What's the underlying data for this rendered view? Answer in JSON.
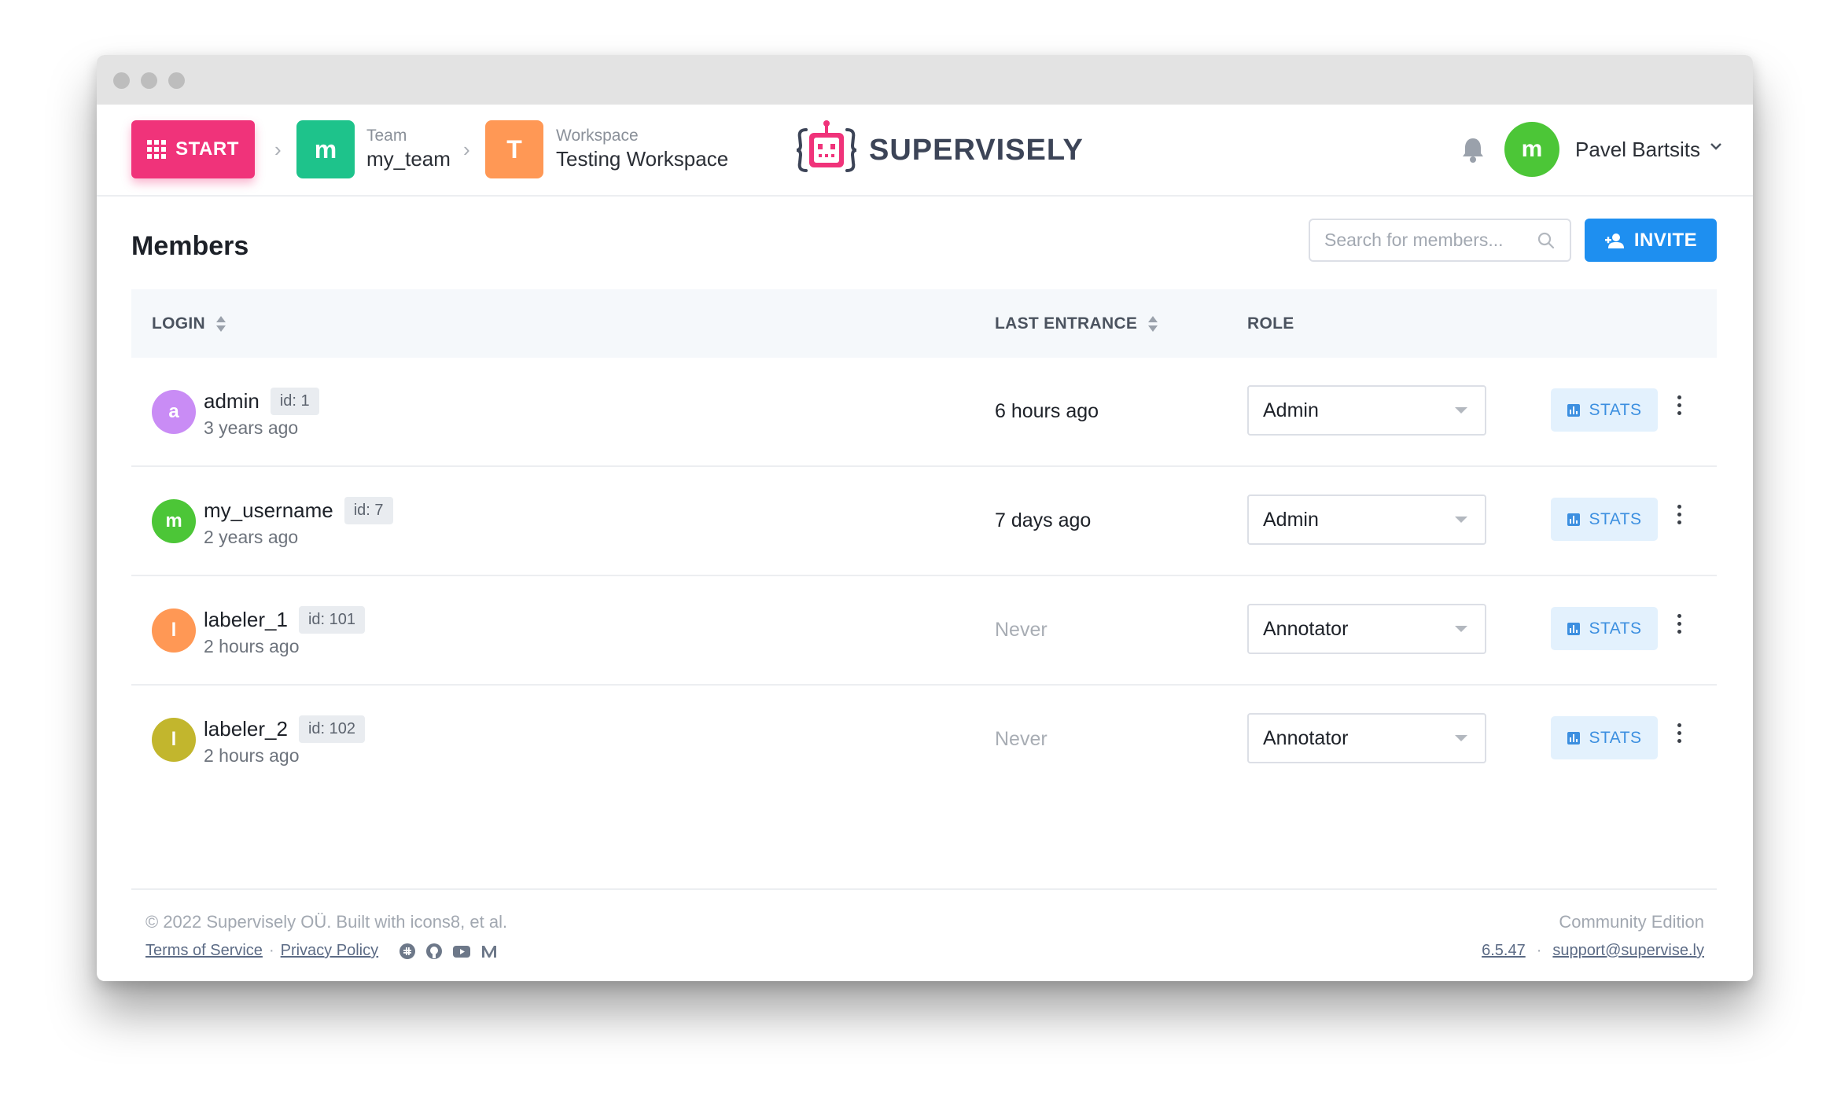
{
  "colors": {
    "start": "#f0337a",
    "team_avatar": "#1ec38b",
    "workspace_avatar": "#ff9855",
    "primary": "#1e8ff0",
    "user_avatar": "#4cc637"
  },
  "header": {
    "start_label": "START",
    "team": {
      "initial": "m",
      "label": "Team",
      "value": "my_team"
    },
    "workspace": {
      "initial": "T",
      "label": "Workspace",
      "value": "Testing Workspace"
    },
    "logo_text": "SUPERVISELY",
    "user": {
      "initial": "m",
      "name": "Pavel Bartsits"
    }
  },
  "main": {
    "title": "Members",
    "search_placeholder": "Search for members...",
    "invite_label": "INVITE",
    "columns": {
      "login": "LOGIN",
      "last_entrance": "LAST ENTRANCE",
      "role": "ROLE"
    },
    "stats_label": "STATS",
    "members": [
      {
        "initial": "a",
        "color": "#c98cf5",
        "login": "admin",
        "id": "id: 1",
        "created": "3 years ago",
        "last": "6 hours ago",
        "role": "Admin"
      },
      {
        "initial": "m",
        "color": "#4cc637",
        "login": "my_username",
        "id": "id: 7",
        "created": "2 years ago",
        "last": "7 days ago",
        "role": "Admin"
      },
      {
        "initial": "l",
        "color": "#ff9855",
        "login": "labeler_1",
        "id": "id: 101",
        "created": "2 hours ago",
        "last": "Never",
        "role": "Annotator"
      },
      {
        "initial": "l",
        "color": "#c2b62d",
        "login": "labeler_2",
        "id": "id: 102",
        "created": "2 hours ago",
        "last": "Never",
        "role": "Annotator"
      }
    ]
  },
  "footer": {
    "copyright": "© 2022 Supervisely OÜ. Built with icons8, et al.",
    "terms": "Terms of Service",
    "privacy": "Privacy Policy",
    "edition": "Community Edition",
    "version": "6.5.47",
    "support": "support@supervise.ly"
  }
}
